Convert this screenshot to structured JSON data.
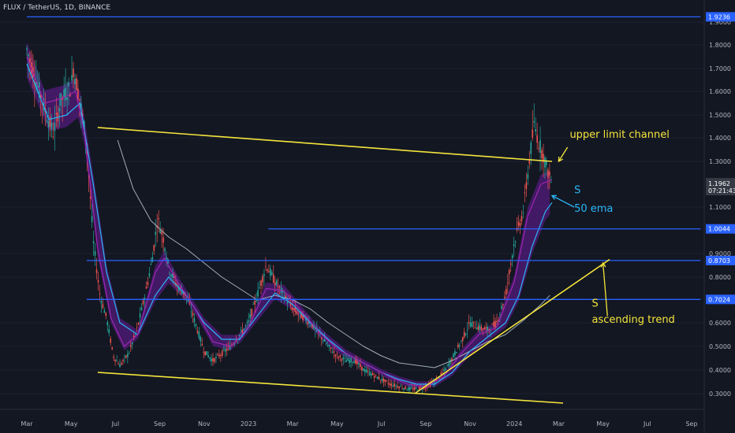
{
  "header": {
    "symbol_label": "FLUX / TetherUS, 1D, BINANCE"
  },
  "chart_data": {
    "type": "candlestick",
    "ylim": [
      0.25,
      1.98
    ],
    "y_ticks": [
      {
        "value": 0.3,
        "label": "0.3000"
      },
      {
        "value": 0.4,
        "label": "0.4000"
      },
      {
        "value": 0.5,
        "label": "0.5000"
      },
      {
        "value": 0.6,
        "label": "0.6000"
      },
      {
        "value": 0.8,
        "label": "0.8000"
      },
      {
        "value": 0.9,
        "label": "0.9000"
      },
      {
        "value": 1.1,
        "label": "1.1000"
      },
      {
        "value": 1.3,
        "label": "1.3000"
      },
      {
        "value": 1.4,
        "label": "1.4000"
      },
      {
        "value": 1.5,
        "label": "1.5000"
      },
      {
        "value": 1.6,
        "label": "1.6000"
      },
      {
        "value": 1.7,
        "label": "1.7000"
      },
      {
        "value": 1.8,
        "label": "1.8000"
      },
      {
        "value": 1.9,
        "label": "1.9000"
      }
    ],
    "x_ticks": [
      "Mar",
      "May",
      "Jul",
      "Sep",
      "Nov",
      "2023",
      "Mar",
      "May",
      "Jul",
      "Sep",
      "Nov",
      "2024",
      "Mar",
      "May",
      "Jul",
      "Sep"
    ],
    "x_tick_index": [
      0,
      1,
      2,
      3,
      4,
      5,
      6,
      7,
      8,
      9,
      10,
      11,
      12,
      13,
      14,
      15
    ],
    "price_tags": [
      {
        "value": 1.9236,
        "label": "1.9236",
        "style": "blue"
      },
      {
        "value": 1.0044,
        "label": "1.0044",
        "style": "blue"
      },
      {
        "value": 0.8703,
        "label": "0.8703",
        "style": "blue"
      },
      {
        "value": 0.7024,
        "label": "0.7024",
        "style": "blue"
      },
      {
        "value": 1.1962,
        "label": "1.1962",
        "sublabel": "07:21:43",
        "style": "last"
      }
    ],
    "series": [
      {
        "kind": "price",
        "points": [
          [
            0,
            1.78
          ],
          [
            0.25,
            1.62
          ],
          [
            0.45,
            1.5
          ],
          [
            0.6,
            1.42
          ],
          [
            0.75,
            1.55
          ],
          [
            0.9,
            1.6
          ],
          [
            1.0,
            1.62
          ],
          [
            1.05,
            1.7
          ],
          [
            1.2,
            1.56
          ],
          [
            1.35,
            1.38
          ],
          [
            1.5,
            0.95
          ],
          [
            1.65,
            0.72
          ],
          [
            1.8,
            0.62
          ],
          [
            1.95,
            0.46
          ],
          [
            2.1,
            0.42
          ],
          [
            2.3,
            0.47
          ],
          [
            2.5,
            0.58
          ],
          [
            2.7,
            0.75
          ],
          [
            2.85,
            0.9
          ],
          [
            2.95,
            1.05
          ],
          [
            3.1,
            0.95
          ],
          [
            3.2,
            0.84
          ],
          [
            3.4,
            0.76
          ],
          [
            3.6,
            0.72
          ],
          [
            3.8,
            0.6
          ],
          [
            4.0,
            0.48
          ],
          [
            4.2,
            0.44
          ],
          [
            4.4,
            0.47
          ],
          [
            4.6,
            0.5
          ],
          [
            4.8,
            0.55
          ],
          [
            5.0,
            0.6
          ],
          [
            5.2,
            0.72
          ],
          [
            5.4,
            0.85
          ],
          [
            5.6,
            0.78
          ],
          [
            5.8,
            0.72
          ],
          [
            6.0,
            0.66
          ],
          [
            6.2,
            0.63
          ],
          [
            6.4,
            0.6
          ],
          [
            6.6,
            0.55
          ],
          [
            6.8,
            0.5
          ],
          [
            7.0,
            0.46
          ],
          [
            7.2,
            0.44
          ],
          [
            7.4,
            0.44
          ],
          [
            7.6,
            0.4
          ],
          [
            7.8,
            0.38
          ],
          [
            8.0,
            0.36
          ],
          [
            8.2,
            0.34
          ],
          [
            8.4,
            0.33
          ],
          [
            8.6,
            0.32
          ],
          [
            8.8,
            0.32
          ],
          [
            9.0,
            0.33
          ],
          [
            9.2,
            0.35
          ],
          [
            9.4,
            0.39
          ],
          [
            9.6,
            0.45
          ],
          [
            9.8,
            0.52
          ],
          [
            10.0,
            0.6
          ],
          [
            10.2,
            0.58
          ],
          [
            10.4,
            0.57
          ],
          [
            10.6,
            0.6
          ],
          [
            10.8,
            0.72
          ],
          [
            11.0,
            0.95
          ],
          [
            11.2,
            1.08
          ],
          [
            11.35,
            1.32
          ],
          [
            11.45,
            1.46
          ],
          [
            11.55,
            1.38
          ],
          [
            11.65,
            1.33
          ],
          [
            11.75,
            1.26
          ],
          [
            11.85,
            1.2
          ]
        ]
      },
      {
        "kind": "ema_fast",
        "points": [
          [
            0,
            1.75
          ],
          [
            0.4,
            1.55
          ],
          [
            0.8,
            1.57
          ],
          [
            1.1,
            1.6
          ],
          [
            1.3,
            1.42
          ],
          [
            1.6,
            0.92
          ],
          [
            1.9,
            0.62
          ],
          [
            2.2,
            0.5
          ],
          [
            2.5,
            0.55
          ],
          [
            2.9,
            0.82
          ],
          [
            3.1,
            0.88
          ],
          [
            3.4,
            0.78
          ],
          [
            3.8,
            0.66
          ],
          [
            4.2,
            0.52
          ],
          [
            4.6,
            0.5
          ],
          [
            5.0,
            0.58
          ],
          [
            5.4,
            0.75
          ],
          [
            5.8,
            0.74
          ],
          [
            6.2,
            0.65
          ],
          [
            6.6,
            0.56
          ],
          [
            7.0,
            0.49
          ],
          [
            7.4,
            0.45
          ],
          [
            7.8,
            0.41
          ],
          [
            8.2,
            0.37
          ],
          [
            8.6,
            0.34
          ],
          [
            9.0,
            0.33
          ],
          [
            9.4,
            0.37
          ],
          [
            9.8,
            0.47
          ],
          [
            10.2,
            0.55
          ],
          [
            10.6,
            0.58
          ],
          [
            11.0,
            0.78
          ],
          [
            11.3,
            1.06
          ],
          [
            11.6,
            1.2
          ],
          [
            11.85,
            1.22
          ]
        ]
      },
      {
        "kind": "ema_50",
        "points": [
          [
            0,
            1.72
          ],
          [
            0.5,
            1.48
          ],
          [
            0.9,
            1.5
          ],
          [
            1.2,
            1.55
          ],
          [
            1.5,
            1.2
          ],
          [
            1.8,
            0.82
          ],
          [
            2.1,
            0.6
          ],
          [
            2.5,
            0.55
          ],
          [
            2.9,
            0.72
          ],
          [
            3.2,
            0.8
          ],
          [
            3.6,
            0.72
          ],
          [
            4.0,
            0.6
          ],
          [
            4.4,
            0.53
          ],
          [
            4.8,
            0.53
          ],
          [
            5.2,
            0.63
          ],
          [
            5.6,
            0.73
          ],
          [
            6.0,
            0.68
          ],
          [
            6.4,
            0.6
          ],
          [
            6.8,
            0.53
          ],
          [
            7.2,
            0.47
          ],
          [
            7.6,
            0.43
          ],
          [
            8.0,
            0.39
          ],
          [
            8.4,
            0.36
          ],
          [
            8.8,
            0.34
          ],
          [
            9.2,
            0.34
          ],
          [
            9.6,
            0.39
          ],
          [
            10.0,
            0.48
          ],
          [
            10.4,
            0.54
          ],
          [
            10.8,
            0.6
          ],
          [
            11.1,
            0.72
          ],
          [
            11.4,
            0.93
          ],
          [
            11.7,
            1.08
          ],
          [
            11.85,
            1.12
          ]
        ]
      },
      {
        "kind": "ema_slow",
        "points": [
          [
            2.05,
            1.39
          ],
          [
            2.4,
            1.18
          ],
          [
            2.8,
            1.04
          ],
          [
            3.2,
            0.97
          ],
          [
            3.6,
            0.92
          ],
          [
            4.0,
            0.86
          ],
          [
            4.4,
            0.8
          ],
          [
            4.8,
            0.75
          ],
          [
            5.2,
            0.7
          ],
          [
            5.6,
            0.72
          ],
          [
            6.0,
            0.7
          ],
          [
            6.4,
            0.66
          ],
          [
            6.8,
            0.6
          ],
          [
            7.2,
            0.55
          ],
          [
            7.6,
            0.5
          ],
          [
            8.0,
            0.46
          ],
          [
            8.4,
            0.43
          ],
          [
            8.8,
            0.42
          ],
          [
            9.2,
            0.41
          ],
          [
            9.6,
            0.44
          ],
          [
            10.0,
            0.48
          ],
          [
            10.4,
            0.52
          ],
          [
            10.8,
            0.55
          ],
          [
            11.2,
            0.61
          ],
          [
            11.6,
            0.68
          ],
          [
            11.8,
            0.72
          ]
        ]
      }
    ],
    "trendlines": [
      {
        "from": [
          1.6,
          1.445
        ],
        "to": [
          11.85,
          1.3
        ],
        "color": "#f5e53c"
      },
      {
        "from": [
          1.6,
          0.39
        ],
        "to": [
          12.1,
          0.26
        ],
        "color": "#f5e53c"
      },
      {
        "from": [
          8.75,
          0.3
        ],
        "to": [
          13.15,
          0.875
        ],
        "color": "#f5e53c"
      }
    ],
    "levels": [
      {
        "value": 1.9236,
        "from": 0,
        "to": 15.2
      },
      {
        "value": 1.0044,
        "from": 5.45,
        "to": 15.2
      },
      {
        "value": 0.8703,
        "from": 1.35,
        "to": 15.2
      },
      {
        "value": 0.7024,
        "from": 1.35,
        "to": 15.2
      }
    ],
    "annotations": [
      {
        "text": "upper limit  channel",
        "x": 12.25,
        "y": 1.4,
        "color": "#f5e53c",
        "size": 13
      },
      {
        "text": "S",
        "x": 12.35,
        "y": 1.16,
        "color": "#29b6f6",
        "size": 13
      },
      {
        "text": "50 ema",
        "x": 12.35,
        "y": 1.08,
        "color": "#29b6f6",
        "size": 13
      },
      {
        "text": "S",
        "x": 12.75,
        "y": 0.67,
        "color": "#f5e53c",
        "size": 13
      },
      {
        "text": "ascending trend",
        "x": 12.75,
        "y": 0.6,
        "color": "#f5e53c",
        "size": 13
      }
    ],
    "arrows": [
      {
        "from": [
          12.2,
          1.36
        ],
        "to": [
          12.0,
          1.3
        ],
        "color": "#f5e53c"
      },
      {
        "from": [
          12.35,
          1.1
        ],
        "to": [
          11.85,
          1.15
        ],
        "color": "#29b6f6"
      },
      {
        "from": [
          13.1,
          0.63
        ],
        "to": [
          13.0,
          0.86
        ],
        "color": "#f5e53c"
      }
    ],
    "colors": {
      "background": "#131722",
      "up": "#26a69a",
      "down": "#ef5350",
      "price": "#d45a6a",
      "ema_fast": "#7b1fa2",
      "ema_50": "#29b6f6",
      "ema_slow": "#b0bec5",
      "level": "#2962ff",
      "trend": "#f5e53c",
      "axis_text": "#b2b5be",
      "tag_blue": "#2962ff",
      "tag_last": "#363a45"
    }
  }
}
